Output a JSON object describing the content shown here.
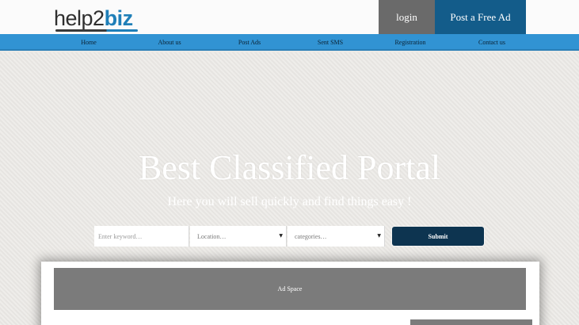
{
  "header": {
    "logo": {
      "part1": "help",
      "part2": "2",
      "part3": "biz"
    },
    "login_label": "login",
    "post_ad_label": "Post a Free Ad"
  },
  "nav": {
    "items": [
      {
        "label": "Home"
      },
      {
        "label": "About us"
      },
      {
        "label": "Post Ads"
      },
      {
        "label": "Sent SMS"
      },
      {
        "label": "Registration"
      },
      {
        "label": "Contact us"
      }
    ]
  },
  "hero": {
    "title": "Best Classified Portal",
    "subtitle": "Here you will sell quickly and find things easy !"
  },
  "search": {
    "keyword_placeholder": "Enter keyword…",
    "location_value": "Location…",
    "category_value": "categories…",
    "submit_label": "Submit"
  },
  "content": {
    "ad_space_label": "Ad Space"
  },
  "colors": {
    "nav_bg": "#3193d3",
    "login_bg": "#6a6a6a",
    "post_bg": "#135c8a",
    "submit_bg": "#0d3450",
    "ad_bg": "#7b7b7b",
    "brand_blue": "#1f7fb8"
  },
  "icons": {
    "select_arrow": "chevron-down-icon"
  }
}
